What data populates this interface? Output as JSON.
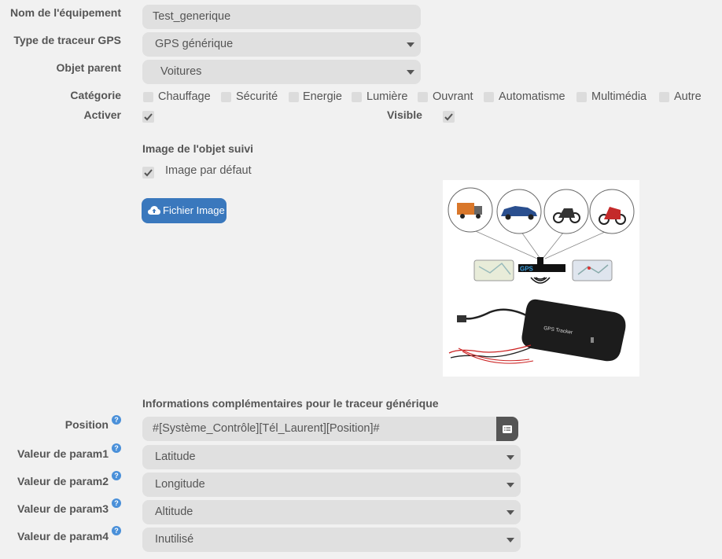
{
  "form": {
    "name_label": "Nom de l'équipement",
    "name_value": "Test_generique",
    "type_label": "Type de traceur GPS",
    "type_value": "GPS générique",
    "parent_label": "Objet parent",
    "parent_value": "Voitures",
    "category_label": "Catégorie",
    "categories": [
      "Chauffage",
      "Sécurité",
      "Energie",
      "Lumière",
      "Ouvrant",
      "Automatisme",
      "Multimédia",
      "Autre"
    ],
    "activer_label": "Activer",
    "visible_label": "Visible"
  },
  "image_section": {
    "title": "Image de l'objet suivi",
    "default_label": "Image par défaut",
    "file_button": "Fichier Image"
  },
  "preview": {
    "gps_badge": "GPS",
    "tracker_label": "GPS Tracker"
  },
  "info_section": {
    "title": "Informations complémentaires pour le traceur générique",
    "position_label": "Position",
    "position_value": "#[Système_Contrôle][Tél_Laurent][Position]#",
    "params": [
      {
        "label": "Valeur de param1",
        "value": "Latitude"
      },
      {
        "label": "Valeur de param2",
        "value": "Longitude"
      },
      {
        "label": "Valeur de param3",
        "value": "Altitude"
      },
      {
        "label": "Valeur de param4",
        "value": "Inutilisé"
      }
    ],
    "help_glyph": "?"
  }
}
